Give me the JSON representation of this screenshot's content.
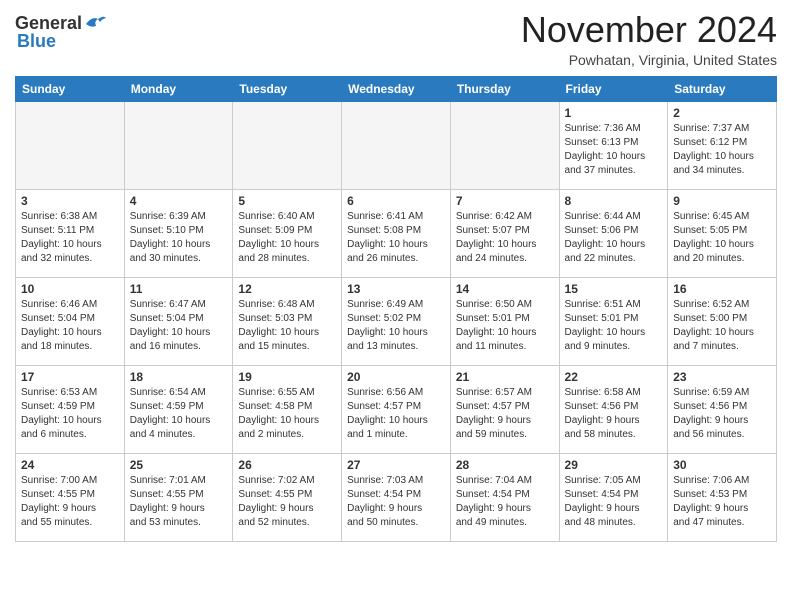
{
  "header": {
    "logo_general": "General",
    "logo_blue": "Blue",
    "month": "November 2024",
    "location": "Powhatan, Virginia, United States"
  },
  "weekdays": [
    "Sunday",
    "Monday",
    "Tuesday",
    "Wednesday",
    "Thursday",
    "Friday",
    "Saturday"
  ],
  "weeks": [
    [
      {
        "day": "",
        "info": ""
      },
      {
        "day": "",
        "info": ""
      },
      {
        "day": "",
        "info": ""
      },
      {
        "day": "",
        "info": ""
      },
      {
        "day": "",
        "info": ""
      },
      {
        "day": "1",
        "info": "Sunrise: 7:36 AM\nSunset: 6:13 PM\nDaylight: 10 hours\nand 37 minutes."
      },
      {
        "day": "2",
        "info": "Sunrise: 7:37 AM\nSunset: 6:12 PM\nDaylight: 10 hours\nand 34 minutes."
      }
    ],
    [
      {
        "day": "3",
        "info": "Sunrise: 6:38 AM\nSunset: 5:11 PM\nDaylight: 10 hours\nand 32 minutes."
      },
      {
        "day": "4",
        "info": "Sunrise: 6:39 AM\nSunset: 5:10 PM\nDaylight: 10 hours\nand 30 minutes."
      },
      {
        "day": "5",
        "info": "Sunrise: 6:40 AM\nSunset: 5:09 PM\nDaylight: 10 hours\nand 28 minutes."
      },
      {
        "day": "6",
        "info": "Sunrise: 6:41 AM\nSunset: 5:08 PM\nDaylight: 10 hours\nand 26 minutes."
      },
      {
        "day": "7",
        "info": "Sunrise: 6:42 AM\nSunset: 5:07 PM\nDaylight: 10 hours\nand 24 minutes."
      },
      {
        "day": "8",
        "info": "Sunrise: 6:44 AM\nSunset: 5:06 PM\nDaylight: 10 hours\nand 22 minutes."
      },
      {
        "day": "9",
        "info": "Sunrise: 6:45 AM\nSunset: 5:05 PM\nDaylight: 10 hours\nand 20 minutes."
      }
    ],
    [
      {
        "day": "10",
        "info": "Sunrise: 6:46 AM\nSunset: 5:04 PM\nDaylight: 10 hours\nand 18 minutes."
      },
      {
        "day": "11",
        "info": "Sunrise: 6:47 AM\nSunset: 5:04 PM\nDaylight: 10 hours\nand 16 minutes."
      },
      {
        "day": "12",
        "info": "Sunrise: 6:48 AM\nSunset: 5:03 PM\nDaylight: 10 hours\nand 15 minutes."
      },
      {
        "day": "13",
        "info": "Sunrise: 6:49 AM\nSunset: 5:02 PM\nDaylight: 10 hours\nand 13 minutes."
      },
      {
        "day": "14",
        "info": "Sunrise: 6:50 AM\nSunset: 5:01 PM\nDaylight: 10 hours\nand 11 minutes."
      },
      {
        "day": "15",
        "info": "Sunrise: 6:51 AM\nSunset: 5:01 PM\nDaylight: 10 hours\nand 9 minutes."
      },
      {
        "day": "16",
        "info": "Sunrise: 6:52 AM\nSunset: 5:00 PM\nDaylight: 10 hours\nand 7 minutes."
      }
    ],
    [
      {
        "day": "17",
        "info": "Sunrise: 6:53 AM\nSunset: 4:59 PM\nDaylight: 10 hours\nand 6 minutes."
      },
      {
        "day": "18",
        "info": "Sunrise: 6:54 AM\nSunset: 4:59 PM\nDaylight: 10 hours\nand 4 minutes."
      },
      {
        "day": "19",
        "info": "Sunrise: 6:55 AM\nSunset: 4:58 PM\nDaylight: 10 hours\nand 2 minutes."
      },
      {
        "day": "20",
        "info": "Sunrise: 6:56 AM\nSunset: 4:57 PM\nDaylight: 10 hours\nand 1 minute."
      },
      {
        "day": "21",
        "info": "Sunrise: 6:57 AM\nSunset: 4:57 PM\nDaylight: 9 hours\nand 59 minutes."
      },
      {
        "day": "22",
        "info": "Sunrise: 6:58 AM\nSunset: 4:56 PM\nDaylight: 9 hours\nand 58 minutes."
      },
      {
        "day": "23",
        "info": "Sunrise: 6:59 AM\nSunset: 4:56 PM\nDaylight: 9 hours\nand 56 minutes."
      }
    ],
    [
      {
        "day": "24",
        "info": "Sunrise: 7:00 AM\nSunset: 4:55 PM\nDaylight: 9 hours\nand 55 minutes."
      },
      {
        "day": "25",
        "info": "Sunrise: 7:01 AM\nSunset: 4:55 PM\nDaylight: 9 hours\nand 53 minutes."
      },
      {
        "day": "26",
        "info": "Sunrise: 7:02 AM\nSunset: 4:55 PM\nDaylight: 9 hours\nand 52 minutes."
      },
      {
        "day": "27",
        "info": "Sunrise: 7:03 AM\nSunset: 4:54 PM\nDaylight: 9 hours\nand 50 minutes."
      },
      {
        "day": "28",
        "info": "Sunrise: 7:04 AM\nSunset: 4:54 PM\nDaylight: 9 hours\nand 49 minutes."
      },
      {
        "day": "29",
        "info": "Sunrise: 7:05 AM\nSunset: 4:54 PM\nDaylight: 9 hours\nand 48 minutes."
      },
      {
        "day": "30",
        "info": "Sunrise: 7:06 AM\nSunset: 4:53 PM\nDaylight: 9 hours\nand 47 minutes."
      }
    ]
  ]
}
